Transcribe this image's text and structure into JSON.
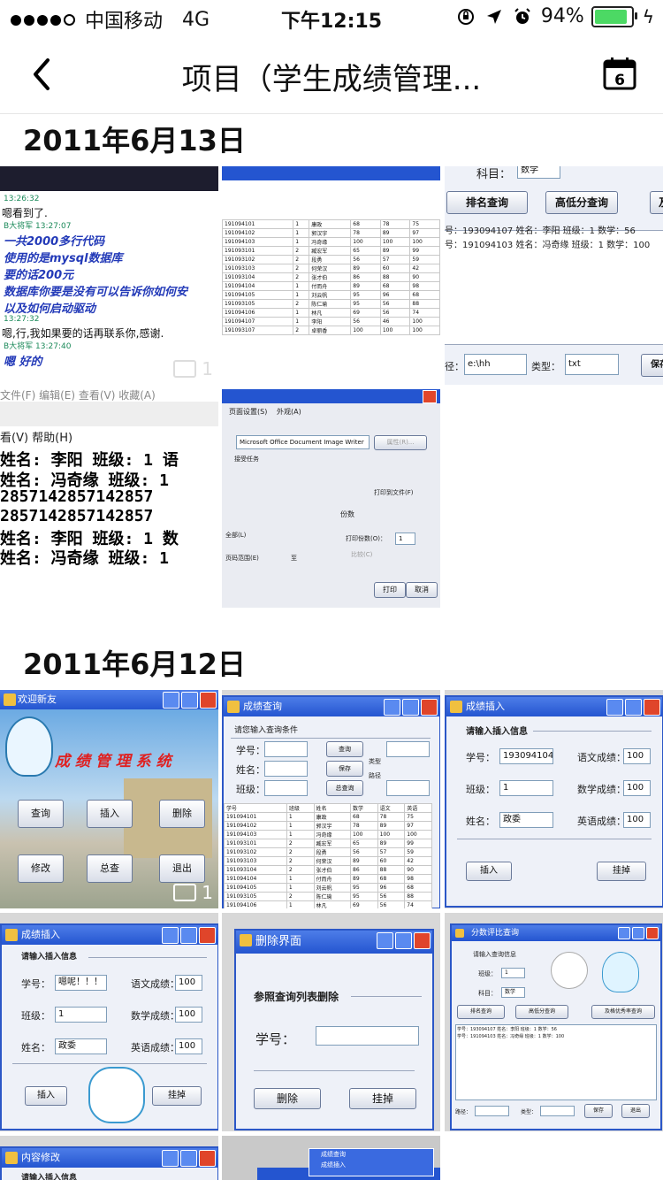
{
  "status_bar": {
    "carrier": "中国移动",
    "network": "4G",
    "time": "下午12:15",
    "battery": "94%"
  },
  "nav": {
    "title": "项目（学生成绩管理...",
    "calendar_day": "6"
  },
  "sections": [
    {
      "date": "2011年6月13日"
    },
    {
      "date": "2011年6月12日"
    }
  ],
  "thumbs": {
    "chat": {
      "t1": "13:26:32",
      "l1": "嗯看到了.",
      "m1": "B大将军  13:27:07",
      "l2": "一共2000多行代码",
      "l3": "使用的是mysql数据库",
      "l4": "要的话200元",
      "l5": "数据库你要是没有可以告诉你如何安",
      "l6": "以及如何启动驱动",
      "t2": "13:27:32",
      "l7": "嗯,行,我如果要的话再联系你,感谢.",
      "m2": "B大将军  13:27:40",
      "l8": "嗯 好的",
      "badge": "1"
    },
    "query_small": {
      "subject_label": "科目：",
      "subject_value": "数学",
      "btn1": "排名查询",
      "btn2": "高低分查询",
      "btn3": "及",
      "r1": "号：193094107 姓名：李阳 班级：1 数学：56",
      "r2": "号：191094103 姓名：冯奇缘 班级：1 数学：100",
      "path_label": "径：",
      "path_value": "e:\\hh",
      "type_label": "类型：",
      "type_value": "txt",
      "save": "保存"
    },
    "notepad": {
      "menu1": "文件(F)   编辑(E)   查看(V)   收藏(A)",
      "menu2": "看(V)  帮助(H)",
      "l1": "姓名:  李阳 班级:  1 语",
      "l2": "姓名:  冯奇缘 班级:  1",
      "l3": "2857142857142857",
      "l4": "2857142857142857",
      "l5": "姓名:  李阳 班级:  1 数",
      "l6": "姓名:  冯奇缘 班级:  1"
    },
    "print": {
      "tab1": "页面设置(S)",
      "tab2": "外观(A)",
      "printer": "Microsoft Office Document Image Writer",
      "props": "属性(R)...",
      "status": "接受任务",
      "to_file": "打印到文件(F)",
      "copies_title": "份数",
      "copies_label": "打印份数(O)：",
      "copies_value": "1",
      "collate": "比较(C)",
      "range_all": "全部(L)",
      "range_pages": "页码范围(E)",
      "range_to": "至",
      "print": "打印",
      "cancel": "取消"
    },
    "main_menu": {
      "title": "欢迎新友",
      "banner": "成 绩 管 理 系 统",
      "b1": "查询",
      "b2": "插入",
      "b3": "删除",
      "b4": "修改",
      "b5": "总查",
      "b6": "退出",
      "badge": "1"
    },
    "grade_query": {
      "title": "成绩查询",
      "prompt": "请您输入查询条件",
      "sid": "学号：",
      "name": "姓名：",
      "cls": "班级：",
      "q": "查询",
      "save": "保存",
      "all": "总查询",
      "type": "类型",
      "path": "路径"
    },
    "insert": {
      "title": "成绩插入",
      "prompt": "请输入插入信息",
      "sid": "学号：",
      "sid_value": "193094104",
      "cls": "班级：",
      "cls_value": "1",
      "name": "姓名：",
      "name_value": "政委",
      "chinese": "语文成绩：",
      "math": "数学成绩：",
      "english": "英语成绩：",
      "score": "100",
      "insert": "插入",
      "hang": "挂掉"
    },
    "insert2": {
      "sid_value": "嗯呢！！！",
      "cls_value": "1",
      "name_value": "政委"
    },
    "delete": {
      "title": "删除界面",
      "ref": "参照查询列表删除",
      "sid": "学号：",
      "del": "删除",
      "hang": "挂掉"
    },
    "score_query": {
      "title": "分数评比查询",
      "prompt": "请输入查询信息",
      "cls": "班级：",
      "cls_value": "1",
      "subject": "科目：",
      "subject_value": "数学",
      "b1": "排名查询",
      "b2": "高低分查询",
      "b3": "及格优秀率查询",
      "r1": "学号：193094107 姓名：李阳 班级：1 数学：56",
      "r2": "学号：191094103 姓名：冯奇缘 班级：1 数学：100",
      "path": "路径：",
      "type": "类型：",
      "save": "保存",
      "exit": "退出"
    },
    "edit": {
      "title": "内容修改",
      "prompt": "请输入插入信息"
    },
    "taskbar": {
      "i1": "成绩查询",
      "i2": "成绩插入"
    }
  },
  "table_rows": [
    [
      "191094101",
      "1",
      "康政",
      "68",
      "78",
      "75"
    ],
    [
      "191094102",
      "1",
      "郭汉宇",
      "78",
      "89",
      "97"
    ],
    [
      "191094103",
      "1",
      "冯奇缘",
      "100",
      "100",
      "100"
    ],
    [
      "191093101",
      "2",
      "臧宏军",
      "65",
      "89",
      "99"
    ],
    [
      "191093102",
      "2",
      "段勇",
      "56",
      "57",
      "59"
    ],
    [
      "191093103",
      "2",
      "何荣汉",
      "89",
      "60",
      "42"
    ],
    [
      "191093104",
      "2",
      "张才伯",
      "86",
      "88",
      "90"
    ],
    [
      "191094104",
      "1",
      "付而舟",
      "89",
      "68",
      "98"
    ],
    [
      "191094105",
      "1",
      "刘云帆",
      "95",
      "96",
      "68"
    ],
    [
      "191093105",
      "2",
      "陈仁瑜",
      "95",
      "56",
      "88"
    ],
    [
      "191094106",
      "1",
      "林凡",
      "69",
      "56",
      "74"
    ],
    [
      "191094107",
      "1",
      "李阳",
      "56",
      "46",
      "100"
    ],
    [
      "191093107",
      "2",
      "卓丽香",
      "100",
      "100",
      "100"
    ]
  ],
  "table_header": [
    "学号",
    "班级",
    "姓名",
    "数学",
    "语文",
    "英语"
  ]
}
